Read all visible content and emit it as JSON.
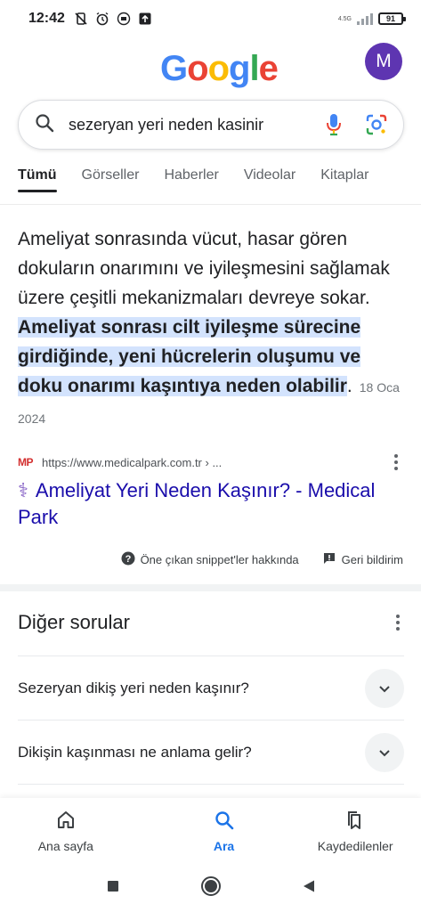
{
  "status_bar": {
    "time": "12:42",
    "network_label": "4.5G",
    "battery": "91"
  },
  "header": {
    "logo_letters": [
      {
        "char": "G",
        "color": "#4285F4"
      },
      {
        "char": "o",
        "color": "#EA4335"
      },
      {
        "char": "o",
        "color": "#FBBC05"
      },
      {
        "char": "g",
        "color": "#4285F4"
      },
      {
        "char": "l",
        "color": "#34A853"
      },
      {
        "char": "e",
        "color": "#EA4335"
      }
    ],
    "avatar_letter": "M",
    "avatar_color": "#5e35b1"
  },
  "search": {
    "query": "sezeryan yeri neden kasinir",
    "icons": [
      "search-icon",
      "mic-icon",
      "lens-icon"
    ]
  },
  "tabs": [
    {
      "label": "Tümü",
      "active": true
    },
    {
      "label": "Görseller",
      "active": false
    },
    {
      "label": "Haberler",
      "active": false
    },
    {
      "label": "Videolar",
      "active": false
    },
    {
      "label": "Kitaplar",
      "active": false
    }
  ],
  "snippet": {
    "text_plain": "Ameliyat sonrasında vücut, hasar gören dokuların onarımını ve iyileşmesini sağlamak üzere çeşitli mekanizmaları devreye sokar.",
    "text_highlight": "Ameliyat sonrası cilt iyileşme sürecine girdiğinde, yeni hücrelerin oluşumu ve doku onarımı kaşıntıya neden olabilir",
    "text_end": ".",
    "date": "18 Oca 2024",
    "source_logo": "MP",
    "source_url": "https://www.medicalpark.com.tr › ...",
    "title_icon": "⚕",
    "title": "Ameliyat Yeri Neden Kaşınır? - Medical Park",
    "about_label": "Öne çıkan snippet'ler hakkında",
    "feedback_label": "Geri bildirim"
  },
  "other_questions": {
    "title": "Diğer sorular",
    "items": [
      {
        "question": "Sezeryan dikiş yeri neden kaşınır?"
      },
      {
        "question": "Dikişin kaşınması ne anlama gelir?"
      }
    ]
  },
  "bottom_nav": {
    "items": [
      {
        "label": "Ana sayfa",
        "icon": "home-icon",
        "active": false
      },
      {
        "label": "Ara",
        "icon": "search-icon",
        "active": true
      },
      {
        "label": "Kaydedilenler",
        "icon": "bookmarks-icon",
        "active": false
      }
    ]
  },
  "colors": {
    "link": "#1a0dab",
    "highlight": "#d3e3fd",
    "active_nav": "#1a73e8"
  }
}
